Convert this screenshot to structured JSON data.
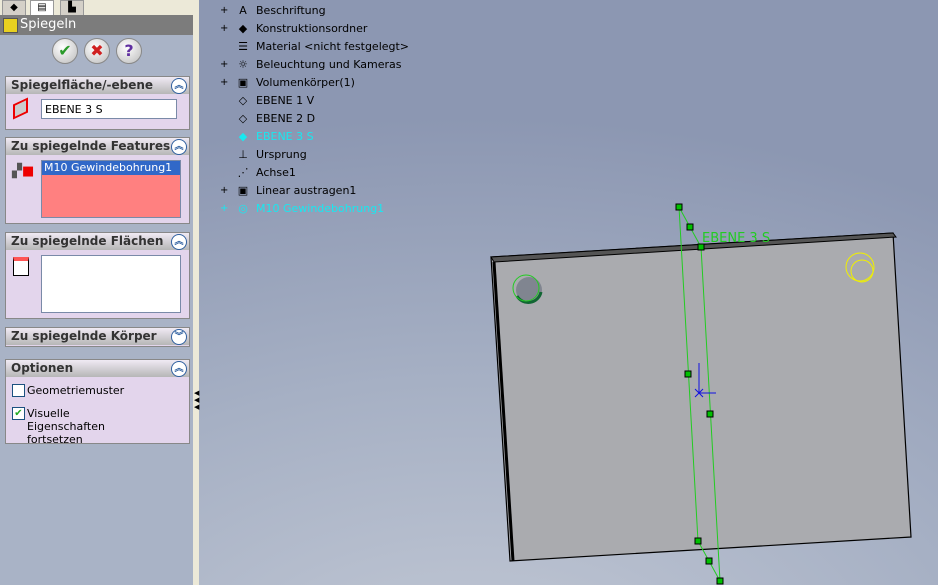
{
  "panel": {
    "title": "Spiegeln",
    "ok_label": "✔",
    "cancel_label": "✖",
    "help_label": "?",
    "mirror_plane": {
      "header": "Spiegelfläche/-ebene",
      "value": "EBENE 3 S"
    },
    "features": {
      "header": "Zu spiegelnde Features",
      "items": [
        "M10 Gewindebohrung1"
      ]
    },
    "faces": {
      "header": "Zu spiegelnde Flächen"
    },
    "bodies": {
      "header": "Zu spiegelnde Körper"
    },
    "options": {
      "header": "Optionen",
      "geometry_pattern": {
        "label": "Geometriemuster",
        "checked": false
      },
      "propagate_visual": {
        "label": "Visuelle Eigenschaften fortsetzen",
        "checked": true
      }
    }
  },
  "tree": [
    {
      "label": "Beschriftung",
      "expand": "+",
      "icon": "annotation-folder-icon",
      "glyph": "A"
    },
    {
      "label": "Konstruktionsordner",
      "expand": "+",
      "icon": "design-folder-icon",
      "glyph": "◆"
    },
    {
      "label": "Material <nicht festgelegt>",
      "expand": "",
      "icon": "material-icon",
      "glyph": "☰"
    },
    {
      "label": "Beleuchtung und Kameras",
      "expand": "+",
      "icon": "lighting-folder-icon",
      "glyph": "☼"
    },
    {
      "label": "Volumenkörper(1)",
      "expand": "+",
      "icon": "solid-bodies-folder-icon",
      "glyph": "▣"
    },
    {
      "label": "EBENE 1 V",
      "expand": "",
      "icon": "plane-icon",
      "glyph": "◇"
    },
    {
      "label": "EBENE 2 D",
      "expand": "",
      "icon": "plane-icon",
      "glyph": "◇"
    },
    {
      "label": "EBENE 3 S",
      "expand": "",
      "icon": "plane-selected-icon",
      "glyph": "◆",
      "selected": true
    },
    {
      "label": "Ursprung",
      "expand": "",
      "icon": "origin-icon",
      "glyph": "⊥"
    },
    {
      "label": "Achse1",
      "expand": "",
      "icon": "axis-icon",
      "glyph": "⋰"
    },
    {
      "label": "Linear austragen1",
      "expand": "+",
      "icon": "extrude-icon",
      "glyph": "▣"
    },
    {
      "label": "M10 Gewindebohrung1",
      "expand": "+",
      "icon": "hole-wizard-icon",
      "glyph": "◎",
      "selected": true
    }
  ],
  "viewport": {
    "plane_label": "EBENE 3 S"
  },
  "colors": {
    "selection": "#18e8f0",
    "plane": "#22cc22",
    "highlight": "#f0f000"
  }
}
